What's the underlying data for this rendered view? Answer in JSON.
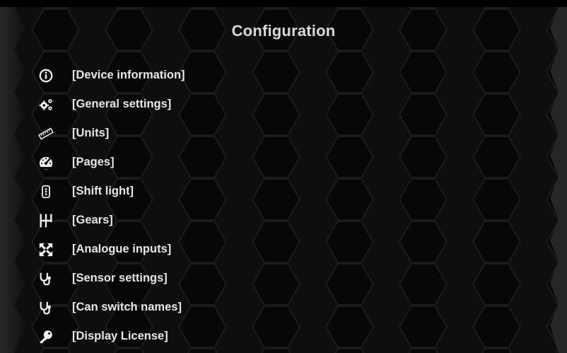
{
  "title": "Configuration",
  "menu": [
    {
      "label": "[Device information]",
      "icon": "info-icon"
    },
    {
      "label": "[General settings]",
      "icon": "gears-icon"
    },
    {
      "label": "[Units]",
      "icon": "ruler-icon"
    },
    {
      "label": "[Pages]",
      "icon": "gauge-icon"
    },
    {
      "label": "[Shift light]",
      "icon": "shift-light-icon"
    },
    {
      "label": "[Gears]",
      "icon": "gear-shifter-icon"
    },
    {
      "label": "[Analogue inputs]",
      "icon": "expand-arrows-icon"
    },
    {
      "label": "[Sensor settings]",
      "icon": "stethoscope-icon"
    },
    {
      "label": "[Can switch names]",
      "icon": "stethoscope-icon"
    },
    {
      "label": "[Display License]",
      "icon": "key-icon"
    }
  ],
  "colors": {
    "background": "#0b0b0b",
    "text": "#e6e6e6",
    "hex_line": "#1f1f1f"
  }
}
